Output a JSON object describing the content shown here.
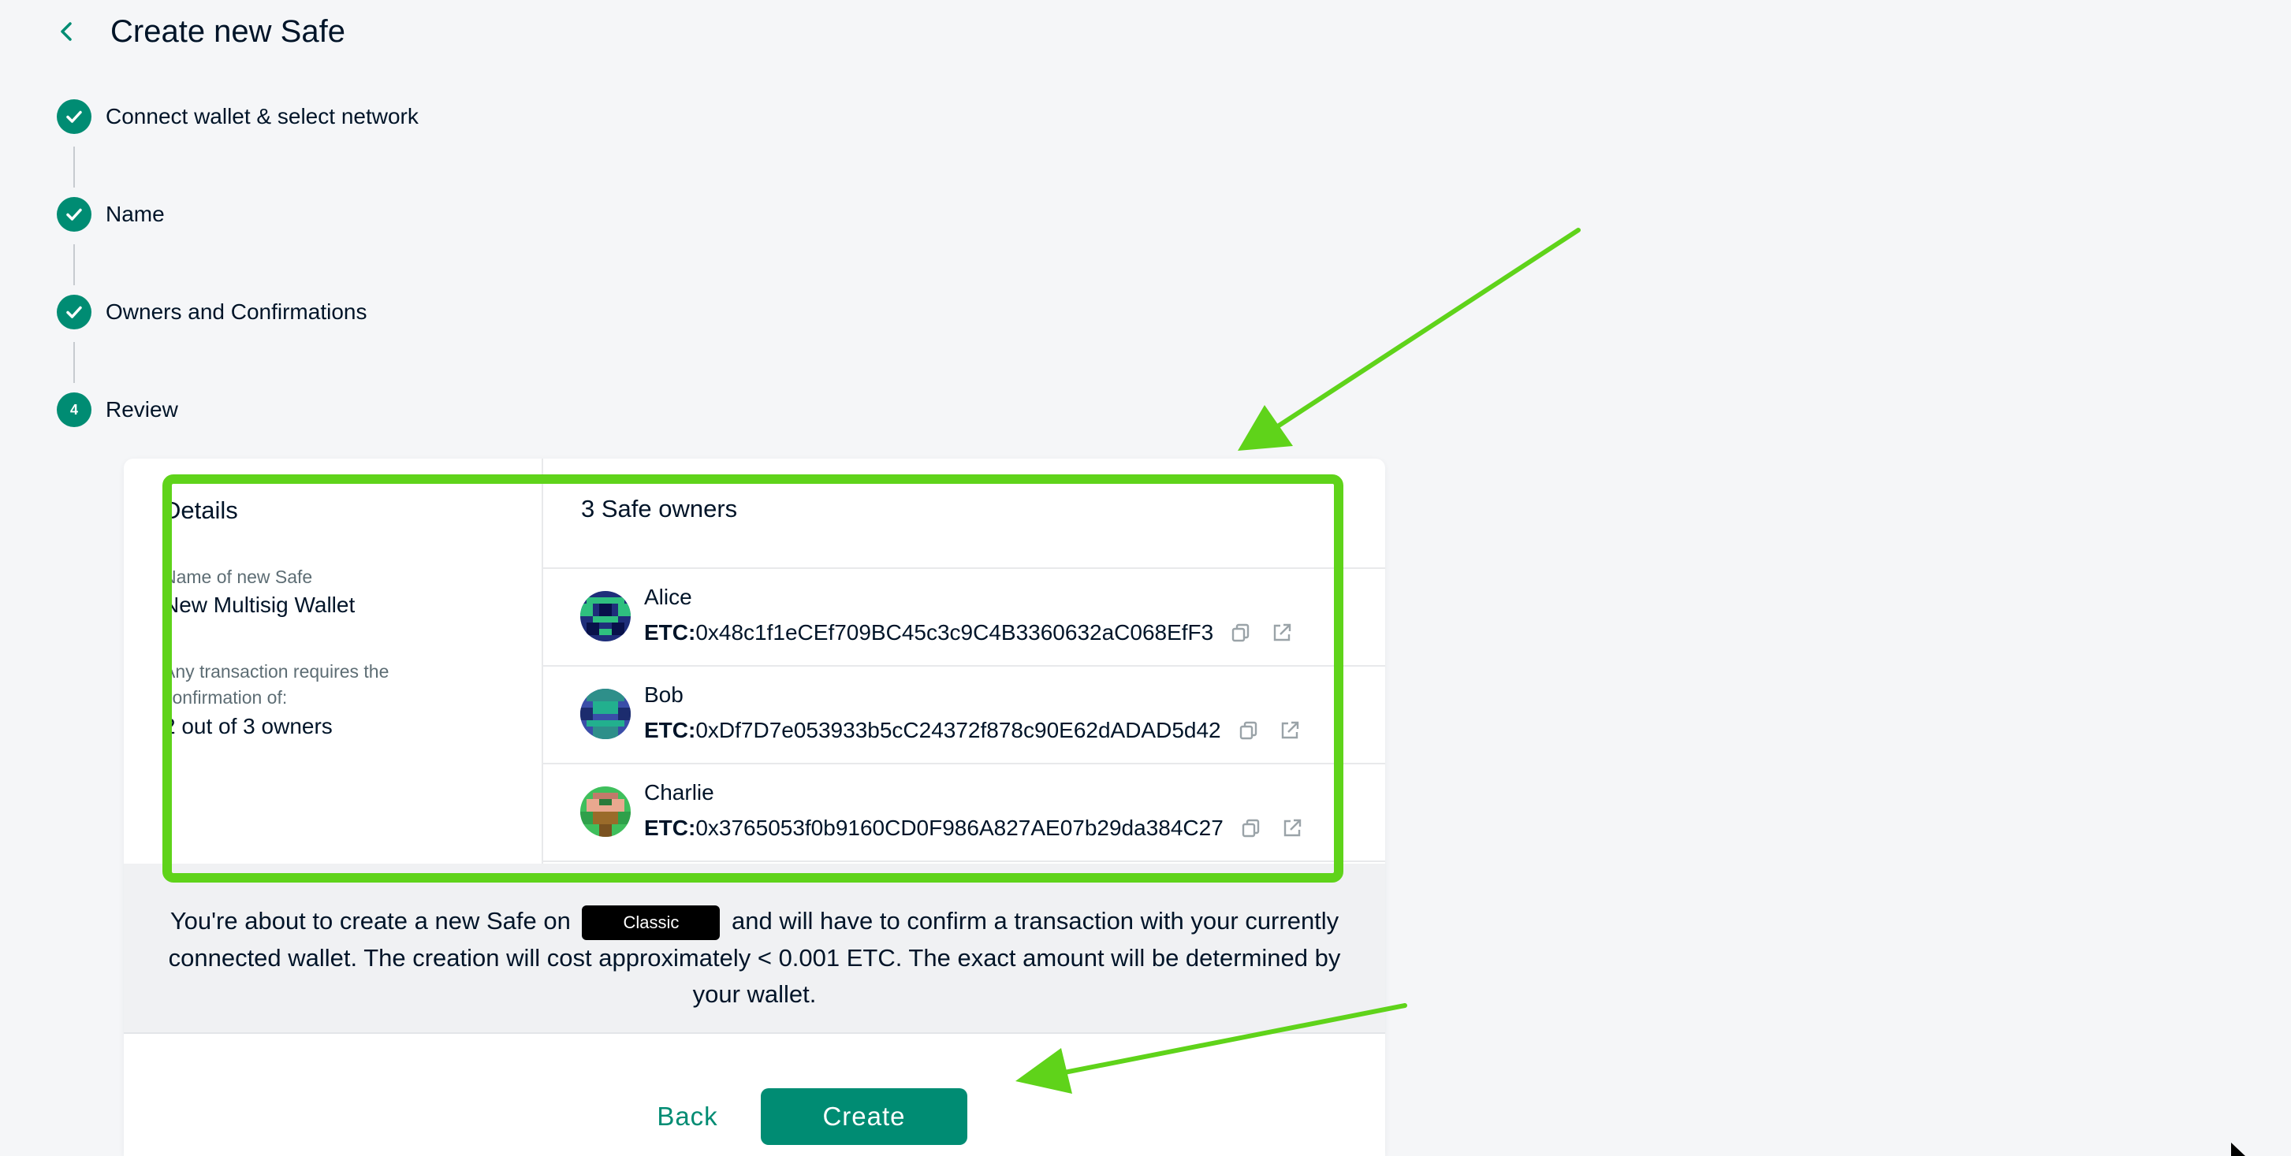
{
  "header": {
    "title": "Create new Safe"
  },
  "stepper": {
    "steps": [
      {
        "label": "Connect wallet & select network",
        "status": "completed",
        "number": "1"
      },
      {
        "label": "Name",
        "status": "completed",
        "number": "2"
      },
      {
        "label": "Owners and Confirmations",
        "status": "completed",
        "number": "3"
      },
      {
        "label": "Review",
        "status": "active",
        "number": "4"
      }
    ]
  },
  "details": {
    "heading": "Details",
    "name_label": "Name of new Safe",
    "name_value": "New Multisig Wallet",
    "threshold_label": "Any transaction requires the confirmation of:",
    "threshold_value": "2 out of 3 owners"
  },
  "owners": {
    "heading": "3 Safe owners",
    "list": [
      {
        "name": "Alice",
        "prefix": "ETC:",
        "address": "0x48c1f1eCEf709BC45c3c9C4B3360632aC068EfF3"
      },
      {
        "name": "Bob",
        "prefix": "ETC:",
        "address": "0xDf7D7e053933b5cC24372f878c90E62dADAD5d42"
      },
      {
        "name": "Charlie",
        "prefix": "ETC:",
        "address": "0x3765053f0b9160CD0F986A827AE07b29da384C27"
      }
    ]
  },
  "info": {
    "part1": "You're about to create a new Safe on",
    "network": "Classic",
    "part2": "and will have to confirm a transaction with your currently connected wallet. The creation will cost approximately < 0.001 ETC. The exact amount will be determined by your wallet."
  },
  "actions": {
    "back_label": "Back",
    "create_label": "Create"
  },
  "colors": {
    "primary": "#008c73",
    "annotation": "#5fd31a",
    "background": "#f5f6f8"
  },
  "icons": [
    "chevron-left-icon",
    "check-icon",
    "copy-icon",
    "external-link-icon",
    "cursor-icon"
  ]
}
